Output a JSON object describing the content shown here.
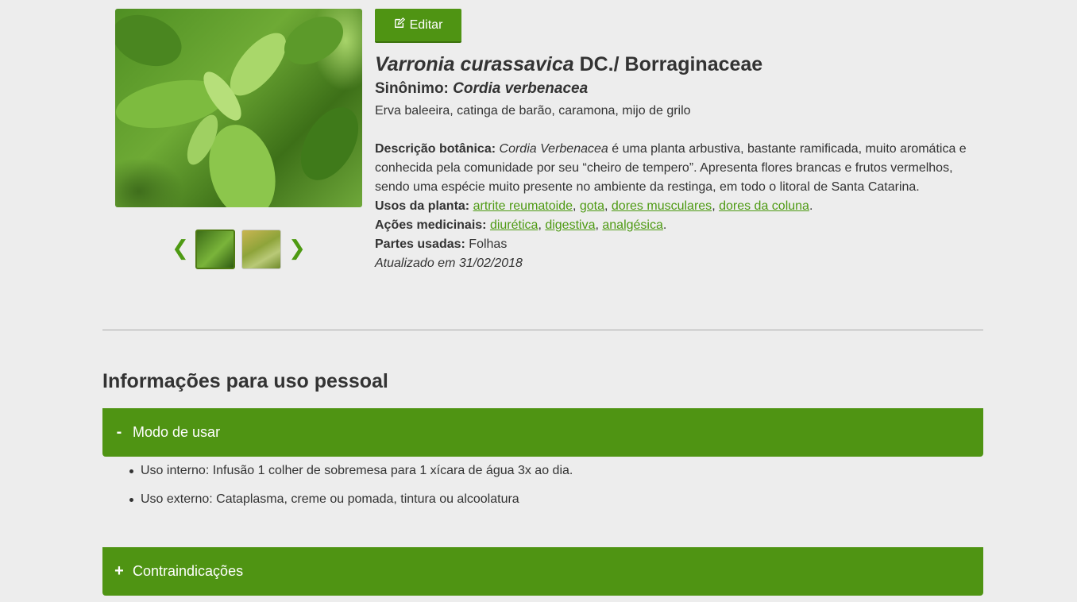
{
  "edit_button": {
    "label": "Editar",
    "icon": "edit-icon"
  },
  "plant": {
    "scientific_name": "Varronia curassavica",
    "authority_family": " DC./ Borraginaceae",
    "synonym_label": "Sinônimo: ",
    "synonym_value": "Cordia verbenacea",
    "common_names": "Erva baleeira, catinga de barão, caramona, mijo de grilo",
    "description_label": "Descrição botânica:",
    "description_name": "Cordia Verbenacea",
    "description_text": " é uma planta arbustiva, bastante ramificada, muito aromática e conhecida pela comunidade por seu “cheiro de tempero”. Apresenta flores brancas e frutos vermelhos, sendo uma espécie muito presente no ambiente da restinga, em todo o litoral de Santa Catarina.",
    "uses_label": "Usos da planta:",
    "uses": [
      "artrite reumatoide",
      "gota",
      "dores musculares",
      "dores da coluna"
    ],
    "actions_label": "Ações medicinais:",
    "actions": [
      "diurética",
      "digestiva",
      "analgésica"
    ],
    "parts_label": "Partes usadas:",
    "parts_value": " Folhas",
    "updated": "Atualizado em 31/02/2018"
  },
  "gallery": {
    "prev_icon": "chevron-left-icon",
    "next_icon": "chevron-right-icon",
    "prev_glyph": "❮",
    "next_glyph": "❯"
  },
  "personal_section": {
    "title": "Informações para uso pessoal",
    "accordions": [
      {
        "sign": "-",
        "label": "Modo de usar",
        "items": [
          "Uso interno: Infusão 1 colher de sobremesa para 1 xícara de água 3x ao dia.",
          "Uso externo: Cataplasma, creme ou pomada, tintura ou alcoolatura"
        ]
      },
      {
        "sign": "+",
        "label": "Contraindicações"
      }
    ]
  },
  "colors": {
    "accent": "#4f9413",
    "link": "#4e9a13",
    "background": "#ededed"
  }
}
